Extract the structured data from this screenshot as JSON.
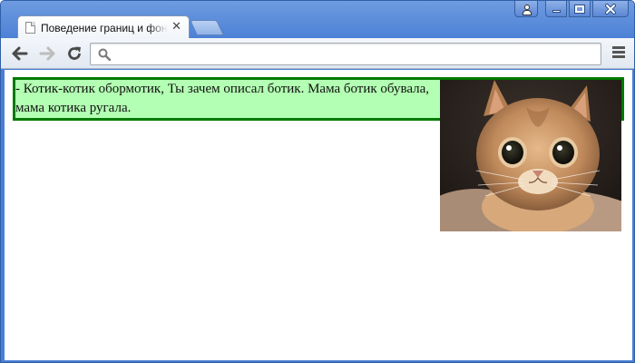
{
  "browser": {
    "tab": {
      "title": "Поведение границ и фона при"
    },
    "icons": {
      "tab_icon": "document-icon",
      "close": "close-icon",
      "back": "back-arrow-icon",
      "forward": "forward-arrow-icon",
      "reload": "reload-icon",
      "search": "search-icon",
      "menu": "hamburger-menu-icon",
      "user": "user-icon"
    },
    "omnibox": {
      "value": ""
    }
  },
  "page": {
    "paragraph": "- Котик-котик обормотик, Ты зачем описал ботик. Мама ботик обувала, мама котика ругала.",
    "box_background": "#b3ffb3",
    "box_border": "#007a00"
  }
}
